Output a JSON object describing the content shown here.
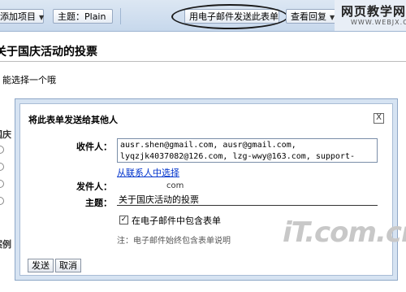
{
  "toolbar": {
    "add_item_label": "添加项目",
    "theme_label": "主题：",
    "theme_value": "Plain",
    "email_form_label": "用电子邮件发送此表单",
    "view_responses_label": "查看回复"
  },
  "logo": {
    "cn": "网页教学网",
    "en": "WWW.WEBJX.COM"
  },
  "form": {
    "title": "关于国庆活动的投票",
    "description": "能选择一个哦",
    "side_label_1": "国庆",
    "side_label_2": "案例"
  },
  "dialog": {
    "title": "将此表单发送给其他人",
    "close_label": "X",
    "recipients_label": "收件人：",
    "recipients_value": "ausr.shen@gmail.com, ausr@gmail.com,\nlyqzjk4037082@126.com, lzg-wwy@163.com, support-",
    "choose_contacts_label": "从联系人中选择",
    "sender_label": "发件人：",
    "sender_value": "com",
    "subject_label": "主题：",
    "subject_value": "关于国庆活动的投票",
    "include_form_checked": true,
    "include_form_label": "在电子邮件中包含表单",
    "note": "注：电子邮件始终包含表单说明",
    "send_label": "发送",
    "cancel_label": "取消"
  },
  "watermark": "iT.com.cn",
  "colors": {
    "toolbar_bg": "#c7d8ec",
    "dialog_frame": "#d6e3f2",
    "link": "#0033cc"
  }
}
